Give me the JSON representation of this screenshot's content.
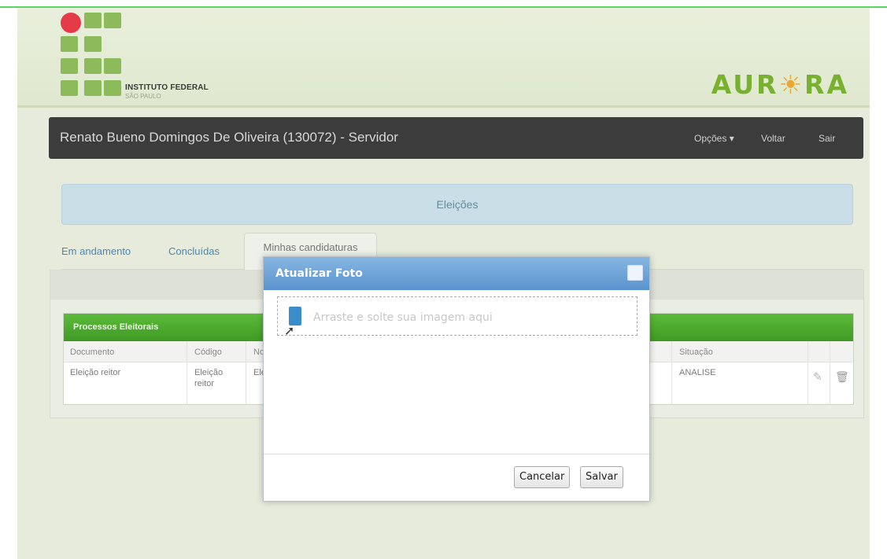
{
  "header": {
    "institute_name": "INSTITUTO FEDERAL",
    "institute_sub": "SÃO PAULO",
    "brand_left": "AUR",
    "brand_right": "RA",
    "brand_sun_icon": "sun-icon"
  },
  "navbar": {
    "user": "Renato Bueno Domingos De Oliveira (130072) - Servidor",
    "options": "Opções ▾",
    "back": "Voltar",
    "logout": "Sair"
  },
  "banner": {
    "title": "Eleições"
  },
  "tabs": [
    {
      "label": "Em andamento"
    },
    {
      "label": "Concluídas"
    },
    {
      "label": "Minhas candidaturas"
    }
  ],
  "panel": {
    "title": "Processos Eleitorais",
    "columns": [
      "Documento",
      "Código",
      "No",
      "Situação"
    ],
    "rows": [
      {
        "documento": "Eleição reitor",
        "codigo_1": "Eleição",
        "codigo_2": "reitor",
        "nome": "Ele",
        "situacao": "ANALISE",
        "edit_icon": "edit-icon",
        "delete_icon": "trash-icon"
      }
    ]
  },
  "modal": {
    "title": "Atualizar Foto",
    "close_icon": "maximize-icon",
    "dropzone_text": "Arraste e solte sua imagem aqui",
    "cancel": "Cancelar",
    "save": "Salvar"
  },
  "colors": {
    "panel_header": "#4aa82c",
    "modal_header": "#6fa3d8",
    "navbar": "#3c3c3c",
    "brand_green": "#78b02f",
    "brand_dot": "#e53b48"
  }
}
